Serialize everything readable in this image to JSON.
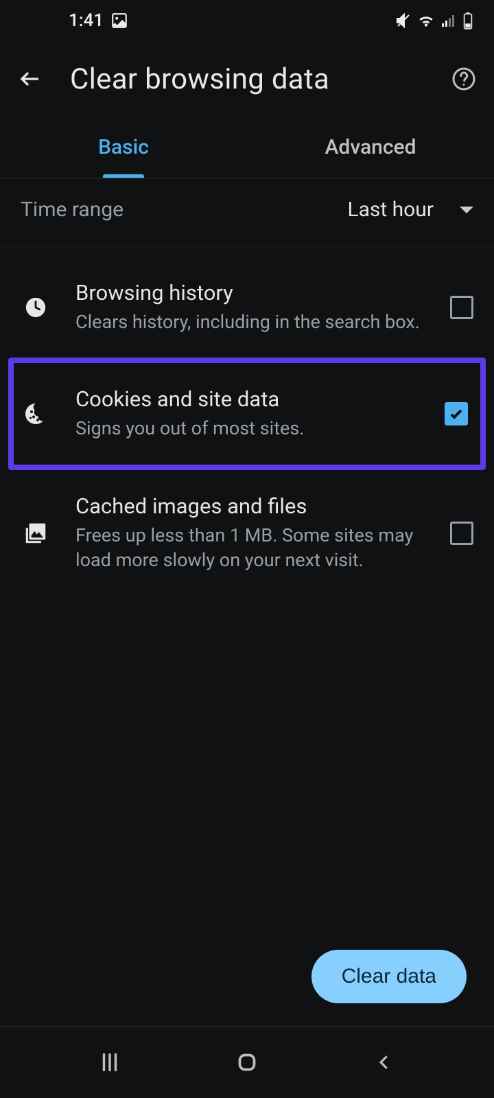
{
  "status": {
    "time": "1:41"
  },
  "header": {
    "title": "Clear browsing data"
  },
  "tabs": {
    "basic": "Basic",
    "advanced": "Advanced"
  },
  "time_range": {
    "label": "Time range",
    "value": "Last hour"
  },
  "items": [
    {
      "title": "Browsing history",
      "desc": "Clears history, including in the search box.",
      "checked": false,
      "highlighted": false
    },
    {
      "title": "Cookies and site data",
      "desc": "Signs you out of most sites.",
      "checked": true,
      "highlighted": true
    },
    {
      "title": "Cached images and files",
      "desc": "Frees up less than 1 MB. Some sites may load more slowly on your next visit.",
      "checked": false,
      "highlighted": false
    }
  ],
  "footer": {
    "clear": "Clear data"
  }
}
